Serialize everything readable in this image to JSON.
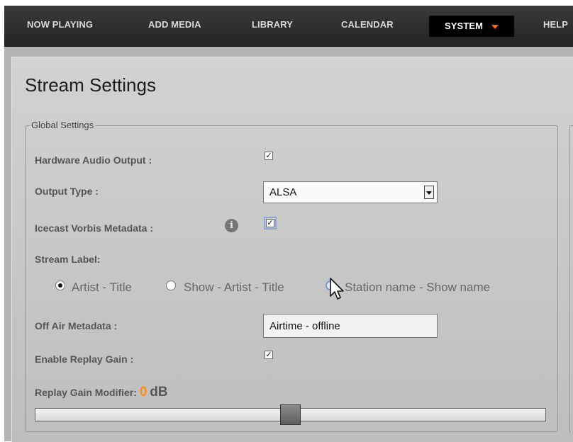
{
  "nav": {
    "items": [
      {
        "label": "NOW PLAYING"
      },
      {
        "label": "ADD MEDIA"
      },
      {
        "label": "LIBRARY"
      },
      {
        "label": "CALENDAR"
      },
      {
        "label": "SYSTEM"
      },
      {
        "label": "HELP"
      }
    ],
    "active": "SYSTEM",
    "active_caret_color": "#ff5f1f"
  },
  "page": {
    "title": "Stream Settings"
  },
  "global_settings": {
    "legend": "Global Settings",
    "hardware_audio_output": {
      "label": "Hardware Audio Output :",
      "checked": true
    },
    "output_type": {
      "label": "Output Type :",
      "value": "ALSA"
    },
    "icecast_vorbis_metadata": {
      "label": "Icecast Vorbis Metadata :",
      "checked": true,
      "info_icon": "info-icon"
    },
    "stream_label": {
      "label": "Stream Label:",
      "options": [
        {
          "text": "Artist - Title",
          "checked": true
        },
        {
          "text": "Show - Artist - Title",
          "checked": false
        },
        {
          "text": "Station name - Show name",
          "checked": false
        }
      ]
    },
    "off_air_metadata": {
      "label": "Off Air Metadata :",
      "value": "Airtime - offline"
    },
    "enable_replay_gain": {
      "label": "Enable Replay Gain :",
      "checked": true
    },
    "replay_gain_modifier": {
      "label": "Replay Gain Modifier:",
      "value": "0",
      "unit": "dB",
      "slider_position": 0.5
    }
  },
  "colors": {
    "accent": "#ff8c1a"
  }
}
